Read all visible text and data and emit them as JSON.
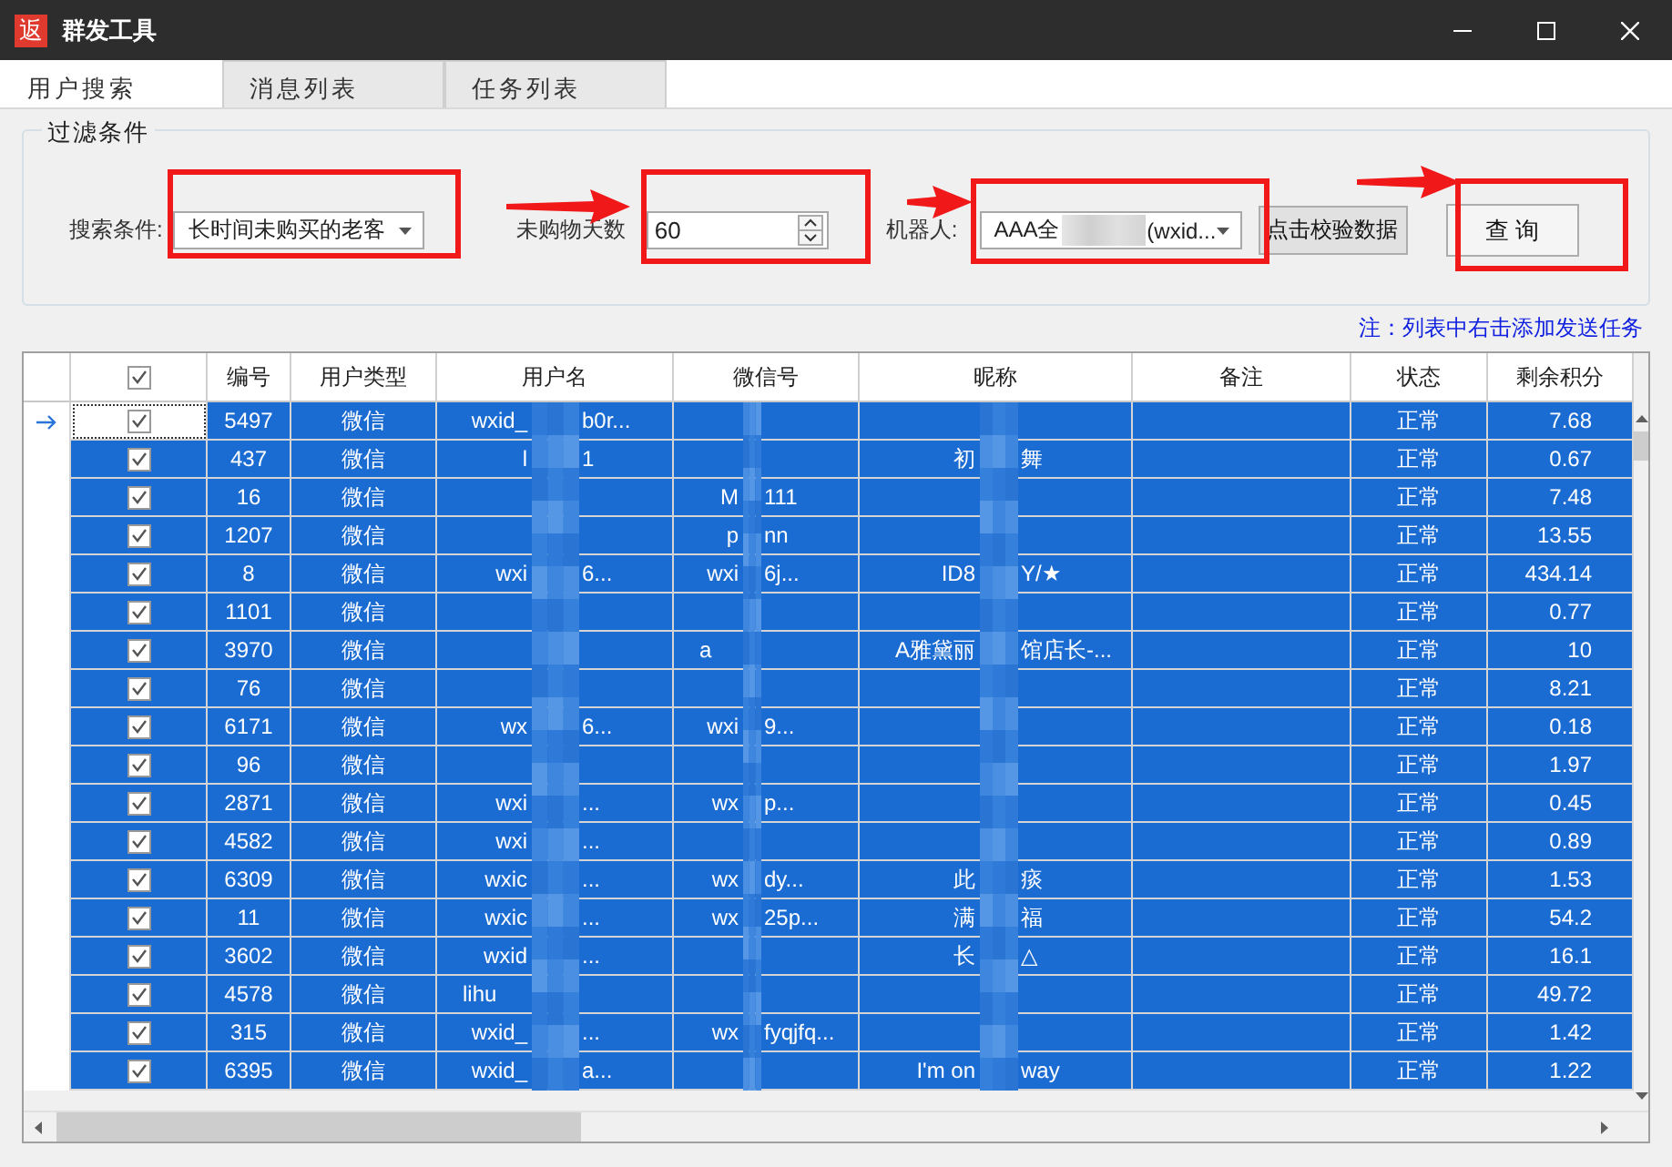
{
  "window": {
    "app_icon": "返",
    "title": "群发工具"
  },
  "tabs": [
    {
      "label": "用户搜索",
      "selected": true
    },
    {
      "label": "消息列表",
      "selected": false
    },
    {
      "label": "任务列表",
      "selected": false
    }
  ],
  "filter": {
    "title": "过滤条件",
    "search_label": "搜索条件:",
    "search_value": "长时间未购买的老客",
    "days_label": "未购物天数",
    "days_value": "60",
    "robot_label": "机器人:",
    "robot_parts": [
      "AAA全",
      "(wxid..."
    ],
    "verify_button": "点击校验数据",
    "query_button": "查 询"
  },
  "note": "注：列表中右击添加发送任务",
  "table": {
    "header_checked": true,
    "columns": [
      "编号",
      "用户类型",
      "用户名",
      "微信号",
      "昵称",
      "备注",
      "状态",
      "剩余积分"
    ],
    "rows": [
      {
        "current": true,
        "selected": true,
        "checked": true,
        "id": "5497",
        "type": "微信",
        "user": [
          "wxid_",
          "b0r..."
        ],
        "wechat": [],
        "nick": [],
        "status": "正常",
        "points": "7.68"
      },
      {
        "current": false,
        "selected": true,
        "checked": true,
        "id": "437",
        "type": "微信",
        "user": [
          "l",
          "1"
        ],
        "wechat": [],
        "nick": [
          "初",
          "舞"
        ],
        "status": "正常",
        "points": "0.67"
      },
      {
        "current": false,
        "selected": true,
        "checked": true,
        "id": "16",
        "type": "微信",
        "user": [],
        "wechat": [
          "M",
          "111"
        ],
        "nick": [],
        "status": "正常",
        "points": "7.48"
      },
      {
        "current": false,
        "selected": true,
        "checked": true,
        "id": "1207",
        "type": "微信",
        "user": [],
        "wechat": [
          "p",
          "nn"
        ],
        "nick": [],
        "status": "正常",
        "points": "13.55"
      },
      {
        "current": false,
        "selected": true,
        "checked": true,
        "id": "8",
        "type": "微信",
        "user": [
          "wxi",
          "6..."
        ],
        "wechat": [
          "wxi",
          "6j..."
        ],
        "nick": [
          "ID8",
          "Y/★"
        ],
        "status": "正常",
        "points": "434.14"
      },
      {
        "current": false,
        "selected": true,
        "checked": true,
        "id": "1101",
        "type": "微信",
        "user": [],
        "wechat": [],
        "nick": [],
        "status": "正常",
        "points": "0.77"
      },
      {
        "current": false,
        "selected": true,
        "checked": true,
        "id": "3970",
        "type": "微信",
        "user": [],
        "wechat": [
          "a"
        ],
        "nick": [
          "A雅黛丽",
          "馆店长-..."
        ],
        "status": "正常",
        "points": "10"
      },
      {
        "current": false,
        "selected": true,
        "checked": true,
        "id": "76",
        "type": "微信",
        "user": [],
        "wechat": [],
        "nick": [],
        "status": "正常",
        "points": "8.21"
      },
      {
        "current": false,
        "selected": true,
        "checked": true,
        "id": "6171",
        "type": "微信",
        "user": [
          "wx",
          "6..."
        ],
        "wechat": [
          "wxi",
          "9..."
        ],
        "nick": [],
        "status": "正常",
        "points": "0.18"
      },
      {
        "current": false,
        "selected": true,
        "checked": true,
        "id": "96",
        "type": "微信",
        "user": [],
        "wechat": [],
        "nick": [],
        "status": "正常",
        "points": "1.97"
      },
      {
        "current": false,
        "selected": true,
        "checked": true,
        "id": "2871",
        "type": "微信",
        "user": [
          "wxi",
          "..."
        ],
        "wechat": [
          "wx",
          "p..."
        ],
        "nick": [],
        "status": "正常",
        "points": "0.45"
      },
      {
        "current": false,
        "selected": true,
        "checked": true,
        "id": "4582",
        "type": "微信",
        "user": [
          "wxi",
          "..."
        ],
        "wechat": [],
        "nick": [],
        "status": "正常",
        "points": "0.89"
      },
      {
        "current": false,
        "selected": true,
        "checked": true,
        "id": "6309",
        "type": "微信",
        "user": [
          "wxic",
          "..."
        ],
        "wechat": [
          "wx",
          "dy..."
        ],
        "nick": [
          "此",
          "痰"
        ],
        "status": "正常",
        "points": "1.53"
      },
      {
        "current": false,
        "selected": true,
        "checked": true,
        "id": "11",
        "type": "微信",
        "user": [
          "wxic",
          "..."
        ],
        "wechat": [
          "wx",
          "25p..."
        ],
        "nick": [
          "满",
          "福"
        ],
        "status": "正常",
        "points": "54.2"
      },
      {
        "current": false,
        "selected": true,
        "checked": true,
        "id": "3602",
        "type": "微信",
        "user": [
          "wxid",
          "..."
        ],
        "wechat": [],
        "nick": [
          "长",
          "△"
        ],
        "status": "正常",
        "points": "16.1"
      },
      {
        "current": false,
        "selected": true,
        "checked": true,
        "id": "4578",
        "type": "微信",
        "user": [
          "lihu"
        ],
        "wechat": [],
        "nick": [],
        "status": "正常",
        "points": "49.72"
      },
      {
        "current": false,
        "selected": true,
        "checked": true,
        "id": "315",
        "type": "微信",
        "user": [
          "wxid_",
          "..."
        ],
        "wechat": [
          "wx",
          "fyqjfq..."
        ],
        "nick": [],
        "status": "正常",
        "points": "1.42"
      },
      {
        "current": false,
        "selected": true,
        "checked": true,
        "id": "6395",
        "type": "微信",
        "user": [
          "wxid_",
          "a..."
        ],
        "wechat": [],
        "nick": [
          "I'm on",
          "way"
        ],
        "status": "正常",
        "points": "1.22"
      }
    ]
  },
  "annotations": [
    {
      "kind": "box"
    },
    {
      "kind": "arrow"
    },
    {
      "kind": "box"
    },
    {
      "kind": "arrow"
    },
    {
      "kind": "box"
    },
    {
      "kind": "arrow"
    },
    {
      "kind": "box"
    }
  ]
}
